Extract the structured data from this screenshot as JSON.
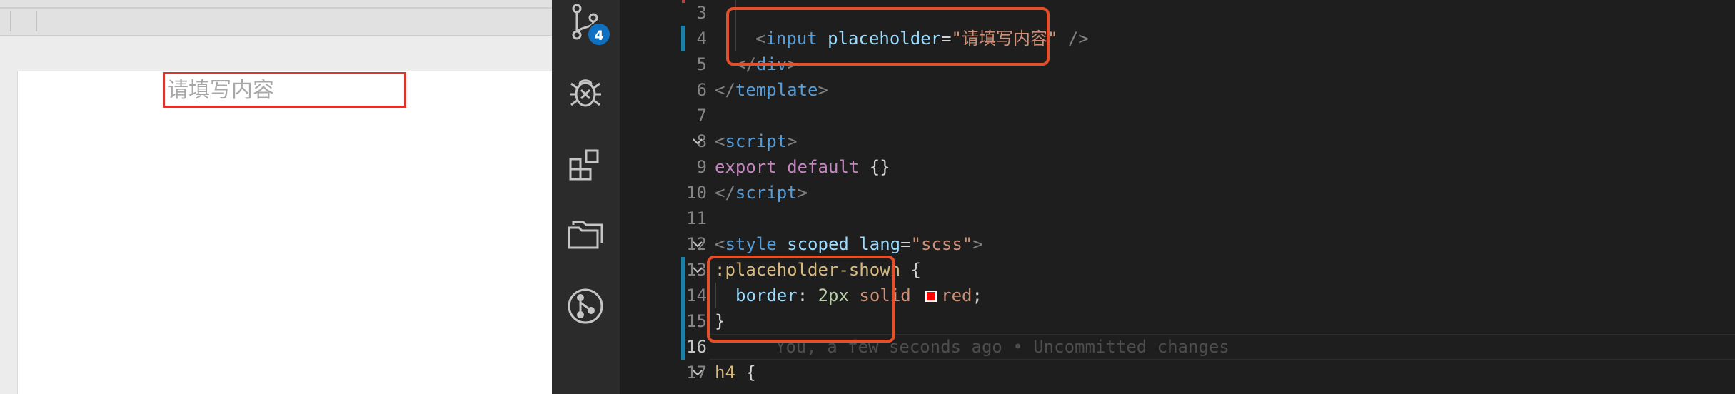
{
  "browser": {
    "input_placeholder": "请填写内容"
  },
  "activity_bar": {
    "items": [
      "source-control",
      "run-and-debug",
      "extensions",
      "explorer",
      "git-graph"
    ],
    "scm_badge": "4",
    "badge_color": "#0e70c0"
  },
  "editor": {
    "lines": [
      {
        "n": "3"
      },
      {
        "n": "4",
        "a": "<",
        "b": "input",
        "c": " placeholder",
        "d": "=",
        "e": "\"请填写内容\"",
        "f": " />"
      },
      {
        "n": "5",
        "a": "</",
        "b": "div",
        "c": ">"
      },
      {
        "n": "6",
        "a": "</",
        "b": "template",
        "c": ">"
      },
      {
        "n": "7"
      },
      {
        "n": "8",
        "a": "<",
        "b": "script",
        "c": ">"
      },
      {
        "n": "9",
        "a": "export default",
        "b": " {}"
      },
      {
        "n": "10",
        "a": "</",
        "b": "script",
        "c": ">"
      },
      {
        "n": "11"
      },
      {
        "n": "12",
        "a": "<",
        "b": "style",
        "c": " scoped",
        "d": " lang",
        "e": "=",
        "f": "\"scss\"",
        "g": ">"
      },
      {
        "n": "13",
        "a": ":placeholder-shown",
        "b": " {"
      },
      {
        "n": "14",
        "a": "border",
        "b": ": ",
        "c": "2px",
        "d": " solid ",
        "e": "red",
        "f": ";"
      },
      {
        "n": "15",
        "a": "}"
      },
      {
        "n": "16"
      },
      {
        "n": "17",
        "a": "h4",
        "b": " {"
      }
    ],
    "blame": "You, a few seconds ago • Uncommitted changes",
    "accent_color": "#e5502a",
    "swatch_color": "#ff0000"
  }
}
